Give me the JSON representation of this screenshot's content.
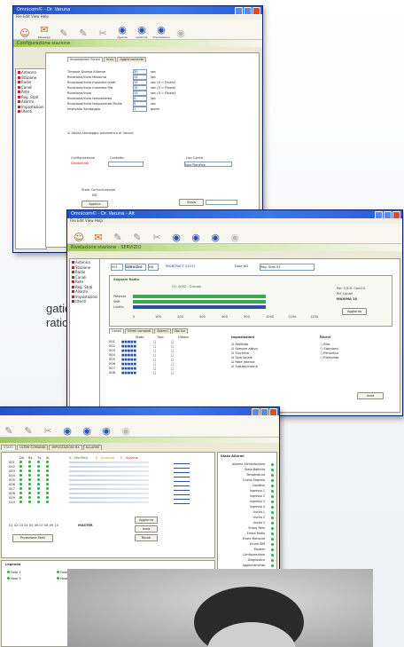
{
  "caption": {
    "line1": "gation",
    "line2": "ration"
  },
  "window1": {
    "title": "Omnicom© - Dr. Varuna",
    "menu": "File  Edit  View  Help",
    "toolbar": [
      {
        "label": "",
        "icon": "person-icon"
      },
      {
        "label": "Messaggi",
        "icon": "mail-icon"
      },
      {
        "label": "",
        "icon": "tool-icon"
      },
      {
        "label": "",
        "icon": "tool-icon"
      },
      {
        "label": "",
        "icon": "tool-icon"
      },
      {
        "label": "Agenda",
        "icon": "globe-icon"
      },
      {
        "label": "Gestione",
        "icon": "globe-icon"
      },
      {
        "label": "Impostazioni",
        "icon": "globe-icon"
      },
      {
        "label": "",
        "icon": "globe-icon"
      }
    ],
    "banner": "Configurazione stazione",
    "tree": [
      "Antenna",
      "Stazione",
      "Radio",
      "Canali",
      "Rete",
      "Reg. Stati",
      "Allarmi",
      "Impostazioni",
      "Utenti"
    ],
    "tabs": [
      "Impostazioni Ricevi",
      "Invia",
      "Aggiornamento"
    ],
    "fields": [
      {
        "label": "Timeout Durata Allarme",
        "value": "30",
        "unit": "sec"
      },
      {
        "label": "Ricezione/Invio Massimo",
        "value": "15",
        "unit": "sec"
      },
      {
        "label": "Ricezione/Invio massimo tratti",
        "value": "15",
        "unit": "sec  (0 = Finale)"
      },
      {
        "label": "Ricezione/Invio massimo file",
        "value": "15",
        "unit": "sec  (0 = Finale)"
      },
      {
        "label": "Ricezione/Invio",
        "value": "15",
        "unit": "sec  (0 = Finale)"
      },
      {
        "label": "Ricezione/Invio temporaneo",
        "value": "5",
        "unit": "sec"
      },
      {
        "label": "Ricezione/Invio temporaneo Finale",
        "value": "5",
        "unit": "sec"
      },
      {
        "label": "Intervallo Sondaggio",
        "value": "1",
        "unit": "giorni"
      }
    ],
    "checkbox_label": "Abilita sondaggio automatico al riavvio",
    "config_label": "Configurazione",
    "config_value": "Disabilitato",
    "contact_label": "Contatto",
    "usage_label": "Uso Carica",
    "usage_value": "Non Pianifica",
    "section_label": "Stato Comunicazione",
    "section_value": "ND",
    "btn_apply": "Applica",
    "btn_save": "Salva"
  },
  "window2": {
    "title": "Omnicom© - Dr. Varuna - Alt",
    "menu": "File  Edit  View  Help",
    "banner": "Rivelazione stazione - SERVIZIO",
    "tree": [
      "Antenna",
      "Stazione",
      "Radio",
      "Canali",
      "Rete",
      "Reg. Stati",
      "Allarmi",
      "Impostazioni",
      "Utenti"
    ],
    "top_fields": [
      "001",
      "SERVIZIO",
      "ND",
      "MAINTRACT 01011",
      "Data ND",
      "Reg. Stati 01"
    ],
    "signal_title": "Segnale Radio",
    "signal_sub": "Ch. 0002 - Gruppo",
    "signal_labels": [
      "Potenza",
      "SNR",
      "Livello"
    ],
    "signal_right": [
      "Par. 0 B.R. Cond.V",
      "Rif. Canali",
      "MAXIMA  10"
    ],
    "axis_ticks": [
      "0",
      "100",
      "200",
      "300",
      "400",
      "500",
      "1000",
      "1100",
      "1200"
    ],
    "bottom_tabs": [
      "Canali",
      "Ultimi comandi",
      "Allarmi",
      "Storico"
    ],
    "list_header": [
      "Stato",
      "Tipo",
      "Ultimo"
    ],
    "list_rows": [
      "001",
      "002",
      "003",
      "004",
      "005",
      "006",
      "007",
      "008"
    ],
    "options_title": "Impostazioni",
    "options": [
      "Abilitato",
      "Sempre attivo",
      "Sincrono",
      "Solo locale",
      "Rete interna",
      "Sottoscrizione"
    ],
    "right_title": "Ricevi",
    "right_opts": [
      "Bloc",
      "Standard",
      "Periodico",
      "Riservato"
    ],
    "btn_refresh": "Aggiorna",
    "btn_send": "Invia"
  },
  "window3": {
    "tabs": [
      "STATO",
      "ULTIMI COMANDI",
      "IMPOSTAZIONI RX",
      "ALLARMI"
    ],
    "legend": [
      "A - Modifica",
      "B - Invertito",
      "C - Allarme"
    ],
    "grid_rows": [
      "001",
      "002",
      "003",
      "004",
      "005",
      "006",
      "007",
      "008",
      "009",
      "010"
    ],
    "grid_cols": [
      "Dir",
      "Rx",
      "Tx",
      "Al"
    ],
    "sequence": "01 02 03 04 05 06 07 08 09 10",
    "sequence_label": "MASTER",
    "btn_a": "Aggiorna",
    "btn_b": "Invia",
    "btn_c": "Ripeti",
    "btn_main": "Proiezione Stati",
    "legend_title": "Legenda",
    "legend_items": [
      "Fase 1",
      "Fase 2",
      "Fase 3",
      "Fase 4",
      "Fase 5",
      "Fase 6"
    ],
    "status_title": "Stato Allarmi",
    "status_items": [
      "Allarme Alimentazione",
      "Stato Batteria",
      "Temperatura",
      "Livello Segnale",
      "Contatto",
      "Ingresso 1",
      "Ingresso 2",
      "Ingresso 3",
      "Ingresso 4",
      "Uscita 1",
      "Uscita 2",
      "Uscita 3",
      "Errore Rete",
      "Errore Radio",
      "Errore Memoria",
      "Errore SIM",
      "Modem",
      "Configurazione",
      "Diagnostica",
      "Aggiornamento",
      "Sincronizzazione",
      "Avvio"
    ]
  }
}
